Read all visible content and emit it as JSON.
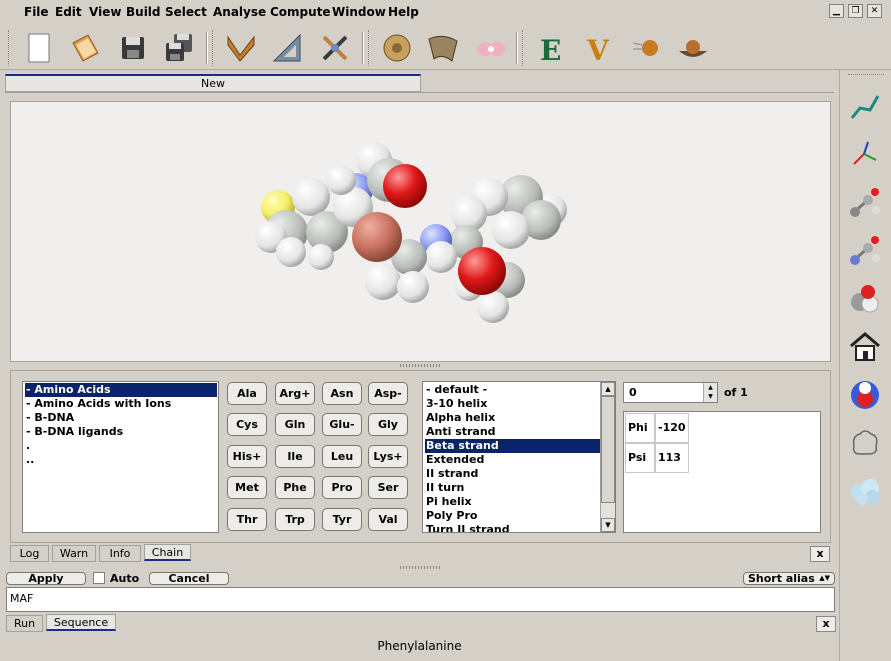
{
  "menu": [
    "File",
    "Edit",
    "View",
    "Build",
    "Select",
    "Analyse",
    "Compute",
    "Window",
    "Help"
  ],
  "window_controls": [
    "minimize",
    "restore",
    "close"
  ],
  "toolbar": {
    "icons": [
      "new-document-icon",
      "open-book-icon",
      "save-icon",
      "save-all-icon",
      "build-angle-icon",
      "triangle-set-icon",
      "molecule-cross-icon",
      "torus-icon",
      "ribbon-shell-icon",
      "orbitals-icon",
      "energy-E-icon",
      "potential-V-icon",
      "comet-icon",
      "dish-icon"
    ]
  },
  "document_tab": {
    "label": "New"
  },
  "amino_sets": {
    "items": [
      "- Amino Acids",
      "- Amino Acids with Ions",
      "- B-DNA",
      "- B-DNA ligands",
      ".",
      ".."
    ],
    "selected_index": 0
  },
  "amino_buttons": [
    "Ala",
    "Arg+",
    "Asn",
    "Asp-",
    "Cys",
    "Gln",
    "Glu-",
    "Gly",
    "His+",
    "Ile",
    "Leu",
    "Lys+",
    "Met",
    "Phe",
    "Pro",
    "Ser",
    "Thr",
    "Trp",
    "Tyr",
    "Val"
  ],
  "conformations": {
    "items": [
      "- default -",
      "3-10 helix",
      "Alpha helix",
      "Anti strand",
      "Beta strand",
      "Extended",
      "II strand",
      "II turn",
      "Pi helix",
      "Poly Pro",
      "Turn II strand"
    ],
    "selected_index": 4
  },
  "spin": {
    "value": "0",
    "of_label": "of 1"
  },
  "angles": [
    {
      "name": "Phi",
      "value": "-120"
    },
    {
      "name": "Psi",
      "value": "113"
    }
  ],
  "bottom_tabs": [
    "Log",
    "Warn",
    "Info",
    "Chain"
  ],
  "active_bottom_tab": "Chain",
  "close_label": "x",
  "action_bar": {
    "apply": "Apply",
    "auto": "Auto",
    "auto_checked": false,
    "cancel": "Cancel",
    "alias_select": "Short alias"
  },
  "sequence_text": "MAF",
  "seq_tabs": [
    "Run",
    "Sequence"
  ],
  "active_seq_tab": "Sequence",
  "status": "Phenylalanine",
  "right_toolbar": [
    "wireframe-stick-icon",
    "axes-stick-icon",
    "ball-stick-icon",
    "ball-stick-blue-icon",
    "spacefill-atoms-icon",
    "home-view-icon",
    "surface-spheres-icon",
    "outline-surface-icon",
    "cloud-surface-icon"
  ],
  "colors": {
    "selection": "#0a246a",
    "carbon": "#c4c8c4",
    "oxygen": "#e01818",
    "nitrogen": "#8c9cf4",
    "sulfur": "#f4f064",
    "hydrogen": "#f6f6f6",
    "copper": "#c87060"
  }
}
